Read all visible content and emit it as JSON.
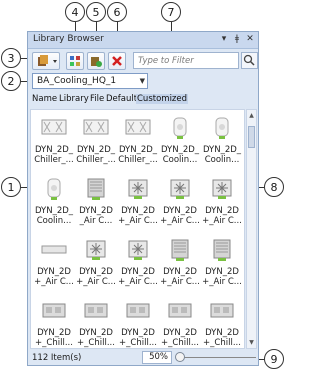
{
  "window": {
    "title": "Library Browser",
    "controls": [
      "▾",
      "ǂ",
      "✕"
    ]
  },
  "callouts": [
    "1",
    "2",
    "3",
    "4",
    "5",
    "6",
    "7",
    "8",
    "9"
  ],
  "toolbar": {
    "filter_placeholder": "Type to Filter"
  },
  "library_select": {
    "value": "BA_Cooling_HQ_1"
  },
  "sort_options": [
    "Name",
    "Library",
    "File",
    "Default",
    "Customized"
  ],
  "items": [
    "DYN_2D_\nChiller_...",
    "DYN_2D_\nChiller_...",
    "DYN_2D_\nChiller_...",
    "DYN_2D_\nCoolin...",
    "DYN_2D_\nCoolin...",
    "DYN_2D_\nCoolin...",
    "DYN_2D\n_Air C...",
    "DYN_2D\n+_Air C...",
    "DYN_2D\n+_Air C...",
    "DYN_2D\n+_Air C...",
    "DYN_2D\n+_Air C...",
    "DYN_2D\n+_Air C...",
    "DYN_2D\n+_Air C...",
    "DYN_2D\n+_Air C...",
    "DYN_2D\n+_Air C...",
    "DYN_2D\n+_Chill...",
    "DYN_2D\n+_Chill...",
    "DYN_2D\n+_Chill...",
    "DYN_2D\n+_Chill...",
    "DYN_2D\n+_Chill..."
  ],
  "status": {
    "count": "112 Item(s)",
    "zoom": "50%"
  }
}
